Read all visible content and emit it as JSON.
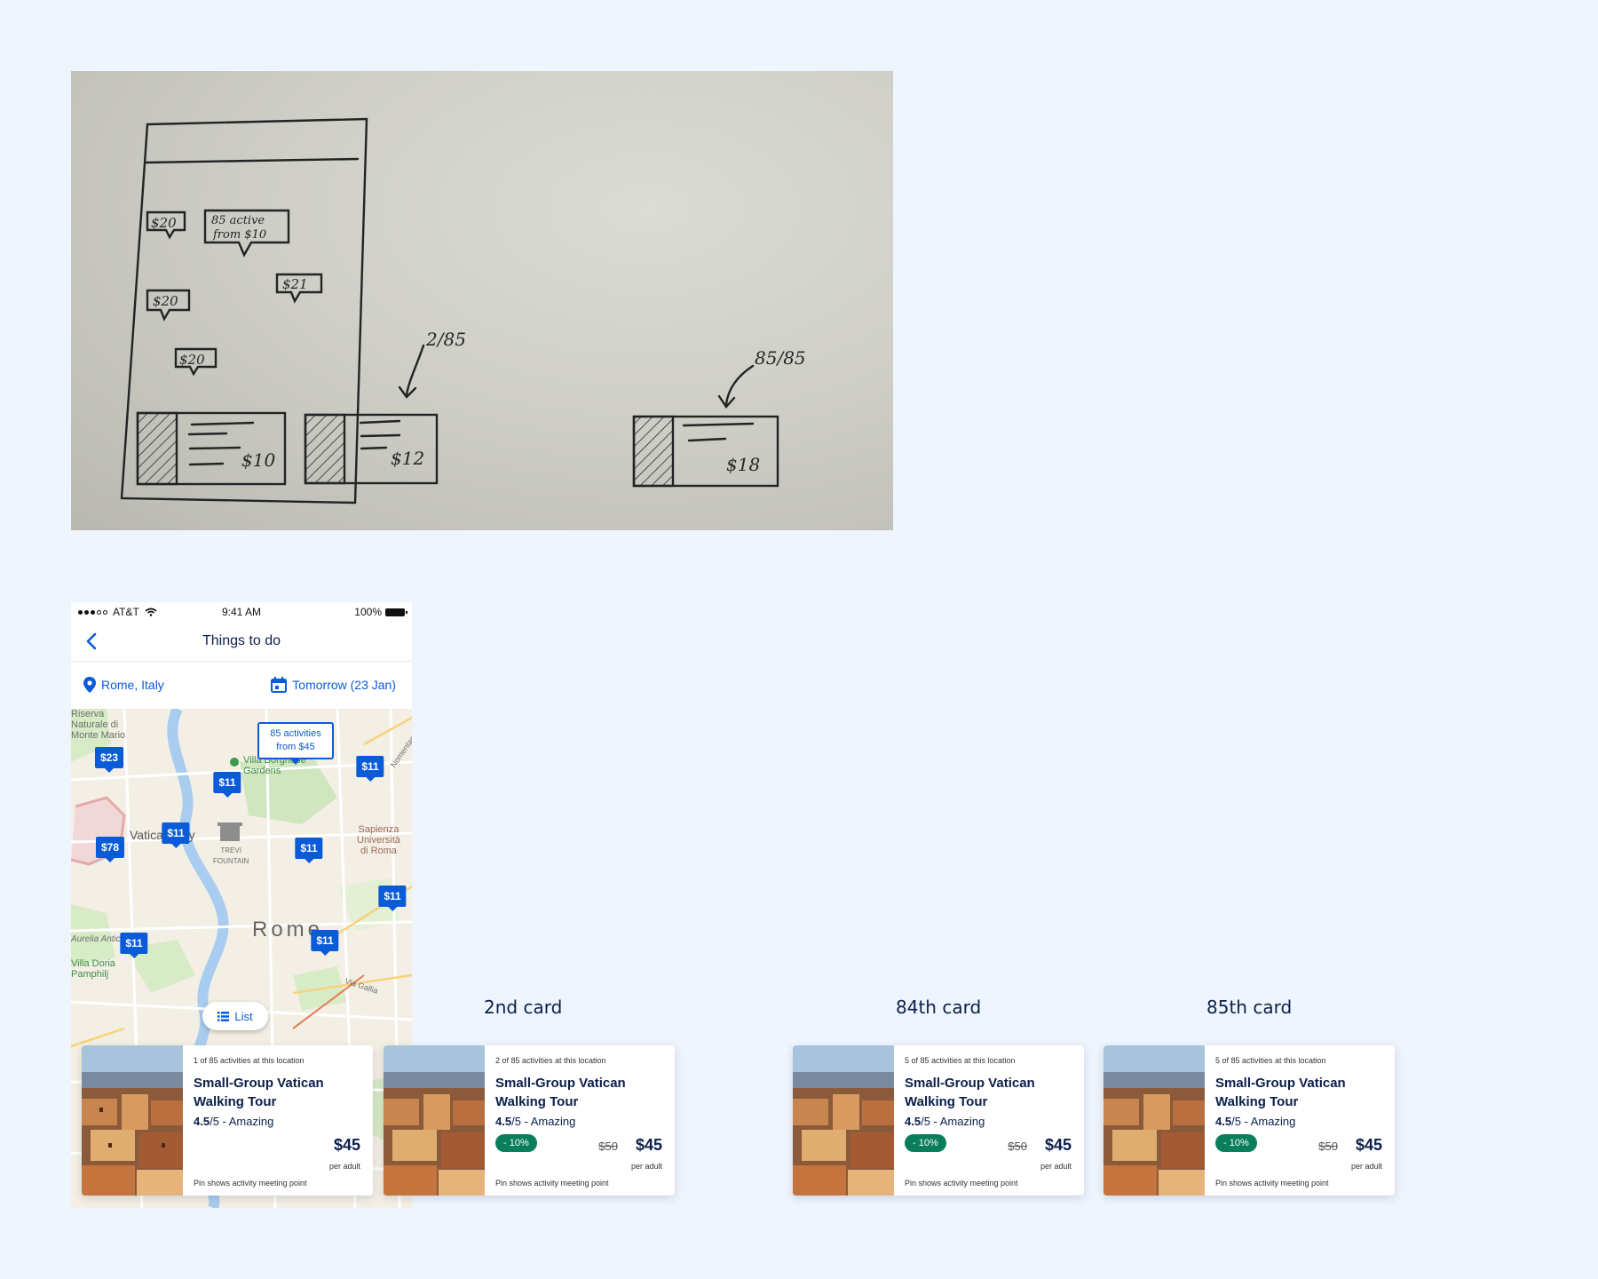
{
  "sketch": {
    "bubbles": [
      "$20",
      "85 active from $10",
      "$20",
      "$21",
      "$20"
    ],
    "card_prices": [
      "$10",
      "$12",
      "$18"
    ],
    "annotations": [
      "2/85",
      "85/85"
    ]
  },
  "phone": {
    "status": {
      "carrier": "AT&T",
      "time": "9:41 AM",
      "battery": "100%"
    },
    "nav": {
      "title": "Things to do"
    },
    "filters": {
      "location": "Rome, Italy",
      "date": "Tomorrow (23 Jan)"
    },
    "map": {
      "labels": [
        "Riserva Naturale di Monte Mario",
        "Villa Borghese Gardens",
        "Vatican City",
        "Sapienza Università di Roma",
        "TREVI FOUNTAIN",
        "Rome",
        "Aurelia Antica",
        "Villa Doria Pamphilj",
        "Nomentana",
        "Via Gallia"
      ],
      "callout_line1": "85 activities",
      "callout_line2": "from $45",
      "pins": [
        "$23",
        "$11",
        "$11",
        "$11",
        "$78",
        "$11",
        "$11",
        "$11",
        "$11"
      ],
      "list_button": "List"
    }
  },
  "captions": {
    "second": "2nd card",
    "eightyfourth": "84th card",
    "eightyfifth": "85th card"
  },
  "cards": [
    {
      "count": "1 of 85 activities at this location",
      "name": "Small-Group Vatican Walking Tour",
      "rating_value": "4.5",
      "rating_rest": "/5 - Amazing",
      "discount": "",
      "old_price": "",
      "price": "$45",
      "per": "per adult",
      "note": "Pin shows activity meeting point"
    },
    {
      "count": "2 of 85 activities at this location",
      "name": "Small-Group Vatican Walking Tour",
      "rating_value": "4.5",
      "rating_rest": "/5 - Amazing",
      "discount": "- 10%",
      "old_price": "$50",
      "price": "$45",
      "per": "per adult",
      "note": "Pin shows activity meeting point"
    },
    {
      "count": "5 of 85 activities at this location",
      "name": "Small-Group Vatican Walking Tour",
      "rating_value": "4.5",
      "rating_rest": "/5 - Amazing",
      "discount": "- 10%",
      "old_price": "$50",
      "price": "$45",
      "per": "per adult",
      "note": "Pin shows activity meeting point"
    },
    {
      "count": "5 of 85 activities at this location",
      "name": "Small-Group Vatican Walking Tour",
      "rating_value": "4.5",
      "rating_rest": "/5 - Amazing",
      "discount": "- 10%",
      "old_price": "$50",
      "price": "$45",
      "per": "per adult",
      "note": "Pin shows activity meeting point"
    }
  ],
  "colors": {
    "accent": "#0a5bd8",
    "discount": "#0a7d5c",
    "background": "#eef5fd",
    "text": "#0b1f4a"
  }
}
